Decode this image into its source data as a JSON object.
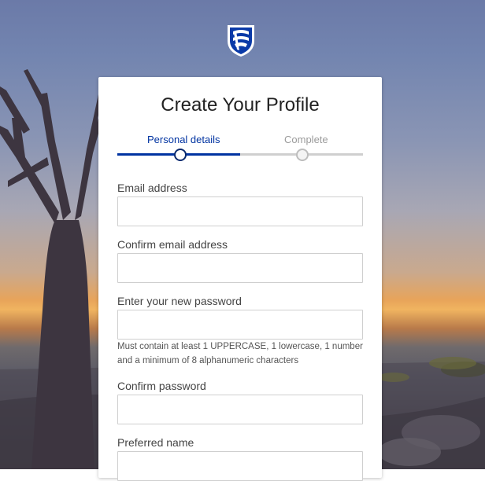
{
  "brand": {
    "logo_icon": "shield-logo-icon",
    "primary_color": "#0033a1"
  },
  "form": {
    "title": "Create Your Profile",
    "steps": [
      {
        "label": "Personal details",
        "state": "active"
      },
      {
        "label": "Complete",
        "state": "inactive"
      }
    ],
    "fields": [
      {
        "label": "Email address",
        "value": "",
        "type": "email"
      },
      {
        "label": "Confirm email address",
        "value": "",
        "type": "email"
      },
      {
        "label": "Enter your new password",
        "value": "",
        "type": "password"
      },
      {
        "label": "Confirm password",
        "value": "",
        "type": "password"
      },
      {
        "label": "Preferred name",
        "value": "",
        "type": "text"
      }
    ],
    "password_hint": "Must contain at least 1 UPPERCASE, 1 lowercase, 1 number and a minimum of 8 alphanumeric characters"
  }
}
